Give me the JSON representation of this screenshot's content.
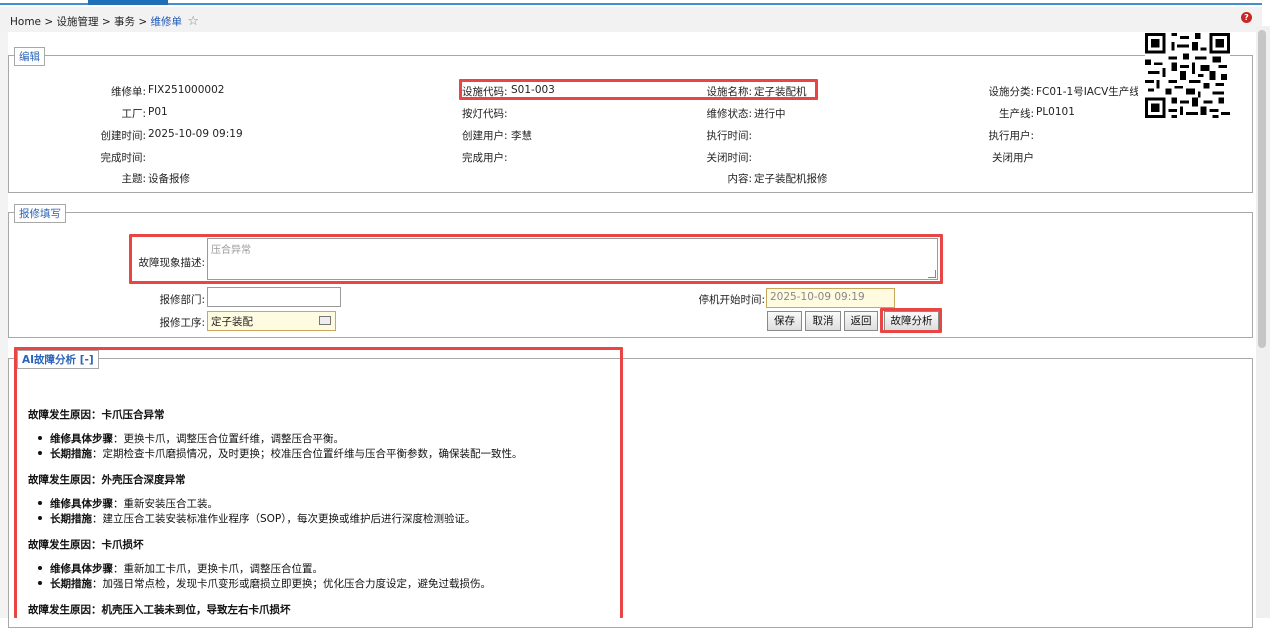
{
  "breadcrumb": {
    "home": "Home",
    "sep": ">",
    "level1": "设施管理",
    "level2": "事务",
    "current": "维修单",
    "star": "☆"
  },
  "help_icon": "?",
  "edit_section": {
    "legend": "编辑",
    "fields": {
      "repair_no": {
        "label": "维修单:",
        "value": "FIX251000002"
      },
      "facility_code": {
        "label": "设施代码:",
        "value": "S01-003"
      },
      "facility_name": {
        "label": "设施名称:",
        "value": "定子装配机"
      },
      "facility_category": {
        "label": "设施分类:",
        "value": "FC01-1号IACV生产线"
      },
      "factory": {
        "label": "工厂:",
        "value": "P01"
      },
      "andon_code": {
        "label": "按灯代码:",
        "value": ""
      },
      "repair_status": {
        "label": "维修状态:",
        "value": "进行中"
      },
      "production_line": {
        "label": "生产线:",
        "value": "PL0101"
      },
      "created_time": {
        "label": "创建时间:",
        "value": "2025-10-09 09:19"
      },
      "created_user": {
        "label": "创建用户:",
        "value": "李慧"
      },
      "exec_time": {
        "label": "执行时间:",
        "value": ""
      },
      "exec_user": {
        "label": "执行用户:",
        "value": ""
      },
      "complete_time": {
        "label": "完成时间:",
        "value": ""
      },
      "complete_user": {
        "label": "完成用户:",
        "value": ""
      },
      "close_time": {
        "label": "关闭时间:",
        "value": ""
      },
      "close_user": {
        "label": "关闭用户",
        "value": ""
      },
      "subject": {
        "label": "主题:",
        "value": "设备报修"
      },
      "content": {
        "label": "内容:",
        "value": "定子装配机报修"
      }
    }
  },
  "repair_section": {
    "legend": "报修填写",
    "fault_desc_label": "故障现象描述:",
    "fault_desc_value": "压合异常",
    "dept_label": "报修部门:",
    "dept_value": "",
    "process_label": "报修工序:",
    "process_value": "定子装配",
    "downtime_label": "停机开始时间:",
    "downtime_value": "2025-10-09 09:19",
    "buttons": {
      "save": "保存",
      "cancel": "取消",
      "back": "返回",
      "fault_analysis": "故障分析"
    }
  },
  "ai_section": {
    "legend": "AI故障分析 [-]",
    "causes": [
      {
        "title": "故障发生原因：卡爪压合异常",
        "items": [
          {
            "label": "维修具体步骤",
            "text": "：更换卡爪，调整压合位置纤维，调整压合平衡。"
          },
          {
            "label": "长期措施",
            "text": "：定期检查卡爪磨损情况，及时更换；校准压合位置纤维与压合平衡参数，确保装配一致性。"
          }
        ]
      },
      {
        "title": "故障发生原因：外壳压合深度异常",
        "items": [
          {
            "label": "维修具体步骤",
            "text": "：重新安装压合工装。"
          },
          {
            "label": "长期措施",
            "text": "：建立压合工装安装标准作业程序（SOP），每次更换或维护后进行深度检测验证。"
          }
        ]
      },
      {
        "title": "故障发生原因：卡爪损坏",
        "items": [
          {
            "label": "维修具体步骤",
            "text": "：重新加工卡爪，更换卡爪，调整压合位置。"
          },
          {
            "label": "长期措施",
            "text": "：加强日常点检，发现卡爪变形或磨损立即更换；优化压合力度设定，避免过载损伤。"
          }
        ]
      },
      {
        "title": "故障发生原因：机壳压入工装未到位，导致左右卡爪损坏",
        "items": []
      }
    ]
  },
  "icons": {
    "star": "star-icon",
    "help": "help-icon",
    "qr": "qr-code",
    "calendar": "calendar-icon"
  },
  "colors": {
    "accent": "#2a64b8",
    "highlight": "#e84545",
    "topbar": "#3f8fd2"
  }
}
